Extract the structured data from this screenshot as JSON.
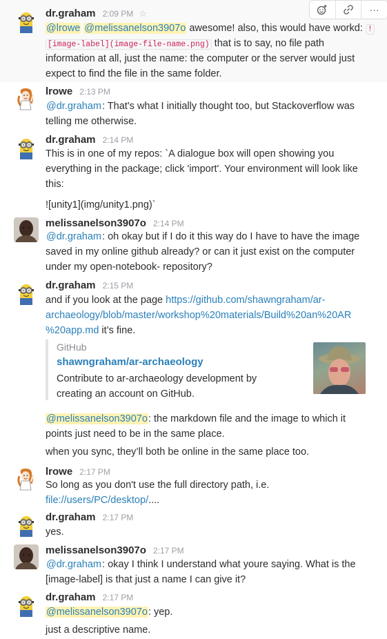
{
  "hover_actions": {
    "reaction_icon": "add-reaction-icon",
    "link_icon": "link-icon",
    "more_icon": "more-icon",
    "more_label": "···"
  },
  "m1": {
    "name": "dr.graham",
    "time": "2:09 PM",
    "l1a": "@lrowe",
    "l1b": "@melissanelson3907o",
    "l1c": " awesome! also, this would have workd: ",
    "l1d": "!",
    "l2a": "[image-label](image-file-name.png)",
    "l2b": " that is to say, no file path",
    "l3": "information at all, just the name: the computer or the server would just",
    "l4": "expect to find the file in the same folder."
  },
  "m2": {
    "name": "lrowe",
    "time": "2:13 PM",
    "l1a": "@dr.graham",
    "l1b": ": That's what I initially thought too, but Stackoverflow was",
    "l2": "telling me otherwise."
  },
  "m3": {
    "name": "dr.graham",
    "time": "2:14 PM",
    "l1": "This is in one of my repos: `A dialogue box will open showing you",
    "l2": "everything in the package; click 'import'. Your environment will look like",
    "l3": "this:",
    "l4": "![unity1](img/unity1.png)`"
  },
  "m4": {
    "name": "melissanelson3907o",
    "time": "2:14 PM",
    "l1a": "@dr.graham",
    "l1b": ": oh okay but if I do it this way do I have to have the image",
    "l2": "saved in my online github already? or can it just exist on the computer",
    "l3": "under my open-notebook- repository?"
  },
  "m5": {
    "name": "dr.graham",
    "time": "2:15 PM",
    "l1a": "and if you look at the page ",
    "l1b": "https://github.com/shawngraham/ar-",
    "l2": "archaeology/blob/master/workshop%20materials/Build%20an%20AR",
    "l3a": "%20app.md",
    "l3b": " it’s fine.",
    "attachment": {
      "source": "GitHub",
      "title": "shawngraham/ar-archaeology",
      "desc1": "Contribute to ar-archaeology development by",
      "desc2": "creating an account on GitHub."
    },
    "l4a": "@melissanelson3907o",
    "l4b": ": the markdown file and the image to which it",
    "l5": "points just need to be in the same place.",
    "l6": "when you sync, they’ll both be online in the same place too."
  },
  "m6": {
    "name": "lrowe",
    "time": "2:17 PM",
    "l1": "So long as you don't use the full directory path, i.e.",
    "l2a": "file://users/PC/desktop/",
    "l2b": "...."
  },
  "m7": {
    "name": "dr.graham",
    "time": "2:17 PM",
    "l1": "yes."
  },
  "m8": {
    "name": "melissanelson3907o",
    "time": "2:17 PM",
    "l1a": "@dr.graham",
    "l1b": ":  okay I think I understand what youre saying. What is the",
    "l2": "[image-label] is that just a name I can give it?"
  },
  "m9": {
    "name": "dr.graham",
    "time": "2:17 PM",
    "l1a": "@melissanelson3907o",
    "l1b": ": yep.",
    "l2": "just a descriptive name."
  }
}
